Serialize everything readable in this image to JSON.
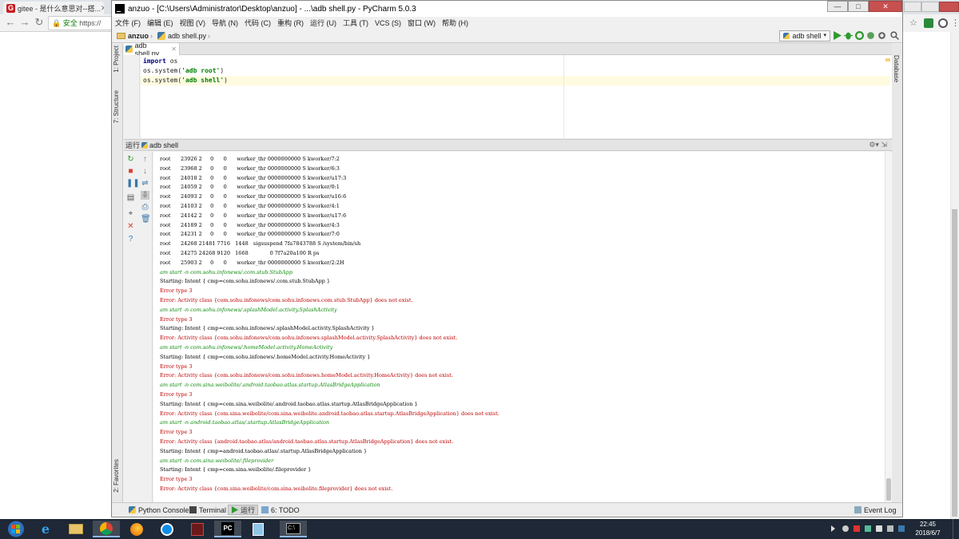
{
  "browser": {
    "tab_title": "gitee - 是什么意思对--搭...",
    "security_label": "安全",
    "url_prefix": "https://"
  },
  "pycharm": {
    "window_title": "anzuo - [C:\\Users\\Administrator\\Desktop\\anzuo] - ...\\adb shell.py - PyCharm 5.0.3",
    "menu": [
      "文件 (F)",
      "编辑 (E)",
      "视图 (V)",
      "导航 (N)",
      "代码 (C)",
      "重构 (R)",
      "运行 (U)",
      "工具 (T)",
      "VCS (S)",
      "窗口 (W)",
      "帮助 (H)"
    ],
    "breadcrumb": {
      "project": "anzuo",
      "file": "adb shell.py"
    },
    "run_config": "adb shell",
    "left_strip": {
      "project": "1: Project",
      "structure": "7: Structure",
      "favorites": "2: Favorites"
    },
    "right_strip": {
      "database": "Database"
    },
    "editor_tab": "adb shell.py",
    "code": [
      {
        "kw": "import",
        "rest": " os"
      },
      {
        "pre": "os.system(",
        "str": "'adb root'",
        "post": ")"
      },
      {
        "pre": "os.system(",
        "str": "'adb shell'",
        "post": ")"
      }
    ],
    "run_panel": {
      "label": "运行",
      "config": "adb shell",
      "console": [
        {
          "t": "normal",
          "text": "root      23926 2     0      0      worker_thr 0000000000 S kworker/7:2"
        },
        {
          "t": "normal",
          "text": "root      23968 2     0      0      worker_thr 0000000000 S kworker/6:3"
        },
        {
          "t": "normal",
          "text": "root      24018 2     0      0      worker_thr 0000000000 S kworker/u17:3"
        },
        {
          "t": "normal",
          "text": "root      24059 2     0      0      worker_thr 0000000000 S kworker/0:1"
        },
        {
          "t": "normal",
          "text": "root      24093 2     0      0      worker_thr 0000000000 S kworker/u16:6"
        },
        {
          "t": "normal",
          "text": "root      24103 2     0      0      worker_thr 0000000000 S kworker/4:1"
        },
        {
          "t": "normal",
          "text": "root      24142 2     0      0      worker_thr 0000000000 S kworker/u17:6"
        },
        {
          "t": "normal",
          "text": "root      24189 2     0      0      worker_thr 0000000000 S kworker/4:3"
        },
        {
          "t": "normal",
          "text": "root      24231 2     0      0      worker_thr 0000000000 S kworker/7:0"
        },
        {
          "t": "normal",
          "text": "root      24268 21481 7716   1448   sigsuspend 7fa7843788 S /system/bin/sh"
        },
        {
          "t": "normal",
          "text": "root      24275 24268 9120   1668             0 7f7a20a100 R ps"
        },
        {
          "t": "normal",
          "text": "root      25903 2     0      0      worker_thr 0000000000 S kworker/2:2H"
        },
        {
          "t": "input",
          "text": "am start -n com.sohu.infonews/.com.stub.StubApp"
        },
        {
          "t": "normal",
          "text": "Starting: Intent { cmp=com.sohu.infonews/.com.stub.StubApp }"
        },
        {
          "t": "err",
          "text": "Error type 3"
        },
        {
          "t": "err",
          "text": "Error: Activity class {com.sohu.infonews/com.sohu.infonews.com.stub.StubApp} does not exist."
        },
        {
          "t": "input",
          "text": "am start -n com.sohu.infonews/.splashModel.activity.SplashActivity"
        },
        {
          "t": "err",
          "text": "Error type 3"
        },
        {
          "t": "normal",
          "text": "Starting: Intent { cmp=com.sohu.infonews/.splashModel.activity.SplashActivity }"
        },
        {
          "t": "err",
          "text": "Error: Activity class {com.sohu.infonews/com.sohu.infonews.splashModel.activity.SplashActivity} does not exist."
        },
        {
          "t": "input",
          "text": "am start -n com.sohu.infonews/.homeModel.activity.HomeActivity"
        },
        {
          "t": "normal",
          "text": "Starting: Intent { cmp=com.sohu.infonews/.homeModel.activity.HomeActivity }"
        },
        {
          "t": "err",
          "text": "Error type 3"
        },
        {
          "t": "err",
          "text": "Error: Activity class {com.sohu.infonews/com.sohu.infonews.homeModel.activity.HomeActivity} does not exist."
        },
        {
          "t": "input",
          "text": "am start -n com.sina.weibolite/.android.taobao.atlas.startup.AtlasBridgeApplication"
        },
        {
          "t": "err",
          "text": "Error type 3"
        },
        {
          "t": "normal",
          "text": "Starting: Intent { cmp=com.sina.weibolite/.android.taobao.atlas.startup.AtlasBridgeApplication }"
        },
        {
          "t": "err",
          "text": "Error: Activity class {com.sina.weibolite/com.sina.weibolite.android.taobao.atlas.startup.AtlasBridgeApplication} does not exist."
        },
        {
          "t": "input",
          "text": "am start -n android.taobao.atlas/.startup.AtlasBridgeApplication"
        },
        {
          "t": "err",
          "text": "Error type 3"
        },
        {
          "t": "err",
          "text": "Error: Activity class {android.taobao.atlas/android.taobao.atlas.startup.AtlasBridgeApplication} does not exist."
        },
        {
          "t": "normal",
          "text": "Starting: Intent { cmp=android.taobao.atlas/.startup.AtlasBridgeApplication }"
        },
        {
          "t": "input",
          "text": "am start -n com.sina.weibolite/.fileprovider"
        },
        {
          "t": "normal",
          "text": "Starting: Intent { cmp=com.sina.weibolite/.fileprovider }"
        },
        {
          "t": "err",
          "text": "Error type 3"
        },
        {
          "t": "err",
          "text": "Error: Activity class {com.sina.weibolite/com.sina.weibolite.fileprovider} does not exist."
        }
      ]
    },
    "bottom_tabs": {
      "python_console": "Python Console",
      "terminal": "Terminal",
      "run": "运行",
      "todo": "6: TODO",
      "event_log": "Event Log"
    }
  },
  "taskbar": {
    "time": "22:45",
    "date": "2018/6/7",
    "app_pycharm_label": "PC"
  },
  "colors": {
    "accent_green": "#0a8a0a",
    "error_red": "#c00000",
    "taskbar": "#1e2836"
  }
}
